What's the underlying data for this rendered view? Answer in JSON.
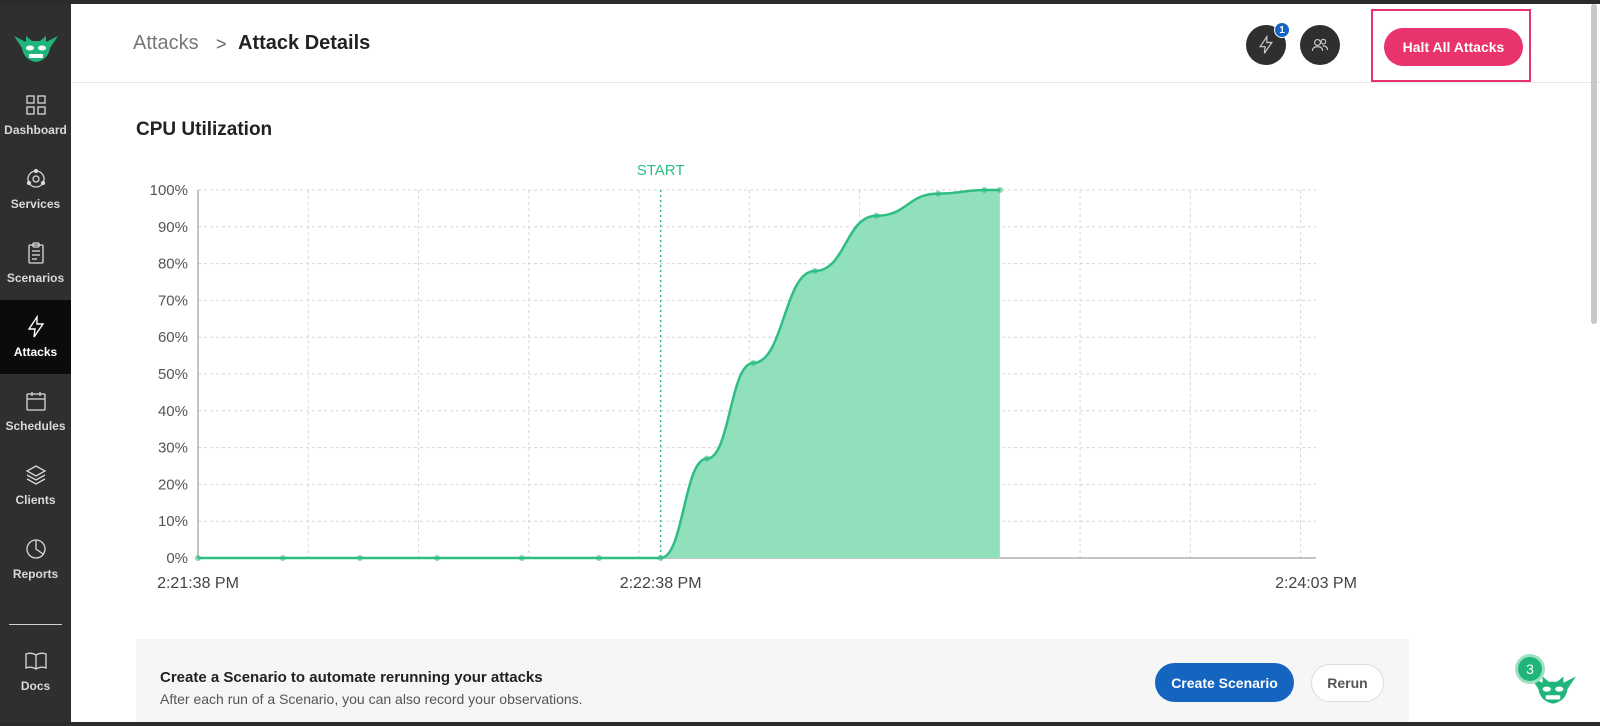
{
  "breadcrumb": {
    "parent": "Attacks",
    "separator": ">",
    "current": "Attack Details"
  },
  "header": {
    "notification_count": "1",
    "halt_button": "Halt All Attacks"
  },
  "sidebar": {
    "items": [
      {
        "label": "Dashboard",
        "icon": "dashboard-icon"
      },
      {
        "label": "Services",
        "icon": "services-icon"
      },
      {
        "label": "Scenarios",
        "icon": "clipboard-icon"
      },
      {
        "label": "Attacks",
        "icon": "lightning-icon",
        "active": true
      },
      {
        "label": "Schedules",
        "icon": "calendar-icon"
      },
      {
        "label": "Clients",
        "icon": "layers-icon"
      },
      {
        "label": "Reports",
        "icon": "pie-chart-icon"
      },
      {
        "label": "Docs",
        "icon": "book-icon"
      }
    ]
  },
  "section": {
    "title": "CPU Utilization"
  },
  "chart_data": {
    "type": "area",
    "title": "",
    "marker": {
      "label": "START",
      "x": "2:22:38 PM"
    },
    "y_ticks": [
      "100%",
      "90%",
      "80%",
      "70%",
      "60%",
      "50%",
      "40%",
      "30%",
      "20%",
      "10%",
      "0%"
    ],
    "x_ticks": [
      "2:21:38 PM",
      "2:22:38 PM",
      "2:24:03 PM"
    ],
    "ylim": [
      0,
      100
    ],
    "xlim_seconds_from_start": [
      0,
      145
    ],
    "series": [
      {
        "x_seconds_from_start": [
          0,
          11,
          21,
          31,
          42,
          52,
          60,
          66,
          72,
          80,
          88,
          96,
          102,
          104
        ],
        "values": [
          0,
          0,
          0,
          0,
          0,
          0,
          0,
          27,
          53,
          78,
          93,
          99,
          100,
          100
        ]
      }
    ],
    "colors": {
      "line": "#2ebd84",
      "fill": "#8fe0bb",
      "marker": "#2ebd84"
    },
    "grid": true
  },
  "cta": {
    "title": "Create a Scenario to automate rerunning your attacks",
    "subtitle": "After each run of a Scenario, you can also record your observations.",
    "primary_button": "Create Scenario",
    "secondary_button": "Rerun"
  },
  "helper": {
    "count": "3"
  }
}
